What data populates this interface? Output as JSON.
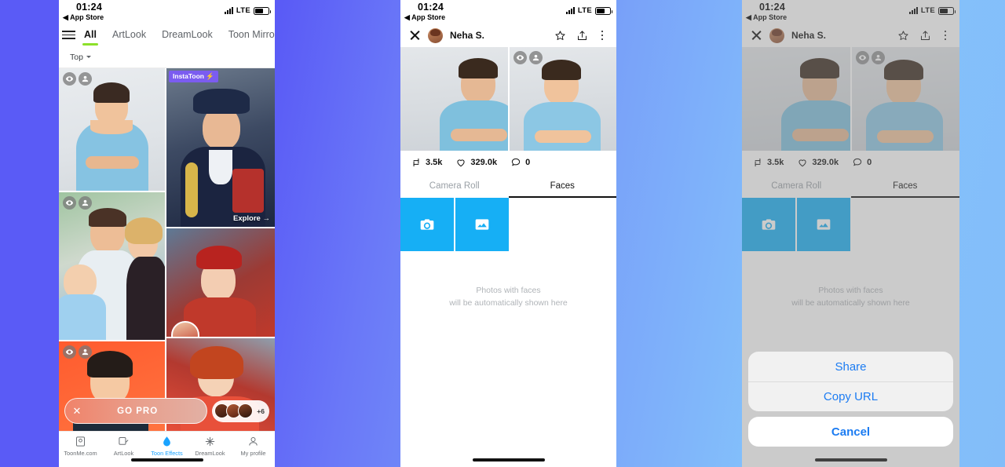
{
  "statusbar": {
    "time": "01:24",
    "back_label": "◀ App Store",
    "network": "LTE"
  },
  "phone1": {
    "tabs": [
      {
        "label": "All",
        "active": true
      },
      {
        "label": "ArtLook",
        "active": false
      },
      {
        "label": "DreamLook",
        "active": false
      },
      {
        "label": "Toon Mirror",
        "active": false
      }
    ],
    "sort_label": "Top",
    "cards": [
      {
        "id": "card-toon-man",
        "tag": "",
        "explore": ""
      },
      {
        "id": "card-instatoon-officer",
        "tag": "InstaToon ⚡",
        "explore": "Explore →"
      },
      {
        "id": "card-family",
        "tag": "",
        "explore": ""
      },
      {
        "id": "card-red-winter",
        "tag": "",
        "explore": ""
      },
      {
        "id": "card-orange-portrait",
        "tag": "",
        "explore": ""
      },
      {
        "id": "card-red-hair",
        "tag": "",
        "explore": ""
      }
    ],
    "gopro": {
      "close": "✕",
      "label": "GO PRO",
      "extra_count": "+6"
    },
    "bottom_nav": [
      {
        "label": "ToonMe.com",
        "icon": "frame-icon",
        "active": false
      },
      {
        "label": "ArtLook",
        "icon": "brush-icon",
        "active": false
      },
      {
        "label": "Toon Effects",
        "icon": "drop-icon",
        "active": true
      },
      {
        "label": "DreamLook",
        "icon": "sparkle-icon",
        "active": false
      },
      {
        "label": "My profile",
        "icon": "person-icon",
        "active": false
      }
    ]
  },
  "phone2": {
    "header": {
      "user": "Neha S.",
      "close": "close-icon",
      "star": "star-icon",
      "share": "share-icon",
      "more": "more-icon"
    },
    "stats": [
      {
        "icon": "repost-icon",
        "value": "3.5k"
      },
      {
        "icon": "heart-icon",
        "value": "329.0k"
      },
      {
        "icon": "comment-icon",
        "value": "0"
      }
    ],
    "tabs": [
      {
        "label": "Camera Roll",
        "active": false
      },
      {
        "label": "Faces",
        "active": true
      }
    ],
    "tiles": [
      {
        "icon": "camera-icon"
      },
      {
        "icon": "gallery-icon"
      }
    ],
    "empty_line1": "Photos with faces",
    "empty_line2": "will be automatically shown here"
  },
  "phone3": {
    "action_sheet": {
      "options": [
        "Share",
        "Copy URL"
      ],
      "cancel": "Cancel"
    }
  },
  "colors": {
    "accent_blue": "#16aff5",
    "link_blue": "#1c7cf2",
    "active_green": "#8ce02a",
    "tag_purple": "#7b5cf0"
  }
}
